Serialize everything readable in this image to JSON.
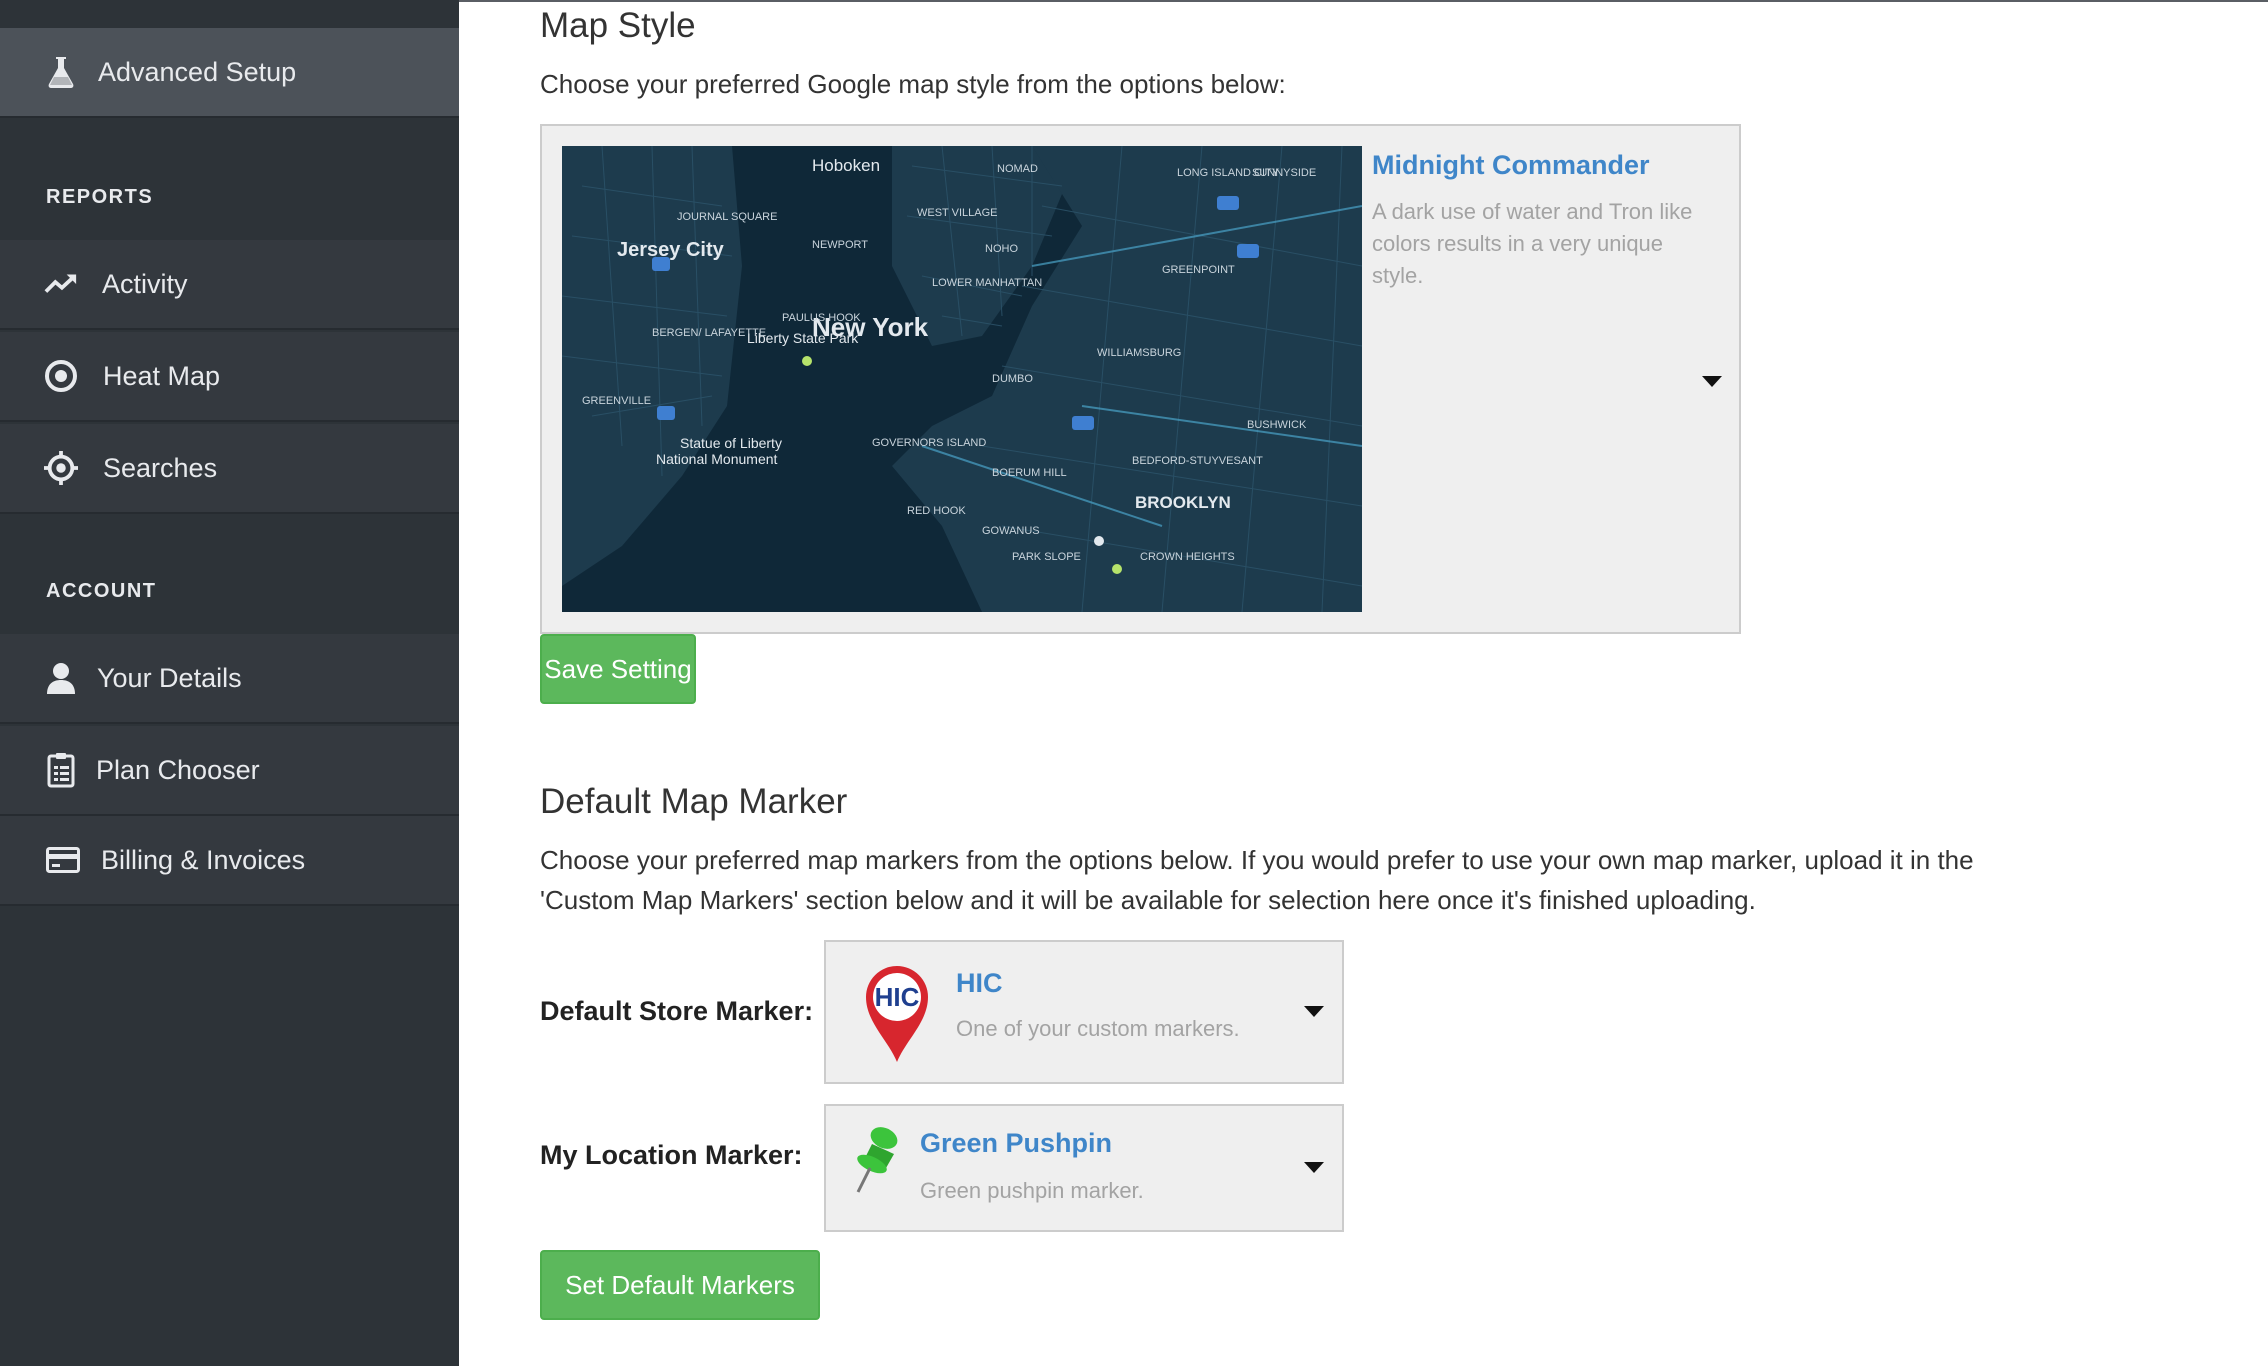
{
  "sidebar": {
    "advanced_setup": "Advanced Setup",
    "reports_heading": "REPORTS",
    "activity": "Activity",
    "heat_map": "Heat Map",
    "searches": "Searches",
    "account_heading": "ACCOUNT",
    "your_details": "Your Details",
    "plan_chooser": "Plan Chooser",
    "billing": "Billing & Invoices",
    "icons": [
      "flask-icon",
      "trend-up-icon",
      "target-icon",
      "crosshair-icon",
      "user-icon",
      "clipboard-icon",
      "credit-card-icon"
    ]
  },
  "map_style": {
    "heading": "Map Style",
    "description": "Choose your preferred Google map style from the options below:",
    "selected_title": "Midnight Commander",
    "selected_desc": "A dark use of water and Tron like colors results in a very unique style.",
    "save_button": "Save Setting",
    "map_labels": {
      "hoboken": "Hoboken",
      "jersey_city": "Jersey City",
      "new_york": "New York",
      "brooklyn": "BROOKLYN",
      "liberty": "Liberty State Park",
      "statue": "Statue of Liberty",
      "statue2": "National Monument",
      "journal_square": "JOURNAL SQUARE",
      "newport": "NEWPORT",
      "paulus_hook": "PAULUS HOOK",
      "west_village": "WEST VILLAGE",
      "lower_manhattan": "LOWER MANHATTAN",
      "williamsburg": "WILLIAMSBURG",
      "greenpoint": "GREENPOINT",
      "dumbo": "DUMBO",
      "boerum_hill": "BOERUM HILL",
      "red_hook": "RED HOOK",
      "park_slope": "PARK SLOPE",
      "crown_heights": "CROWN HEIGHTS",
      "governors_island": "GOVERNORS ISLAND",
      "greenville": "GREENVILLE",
      "bergen": "BERGEN/ LAFAYETTE",
      "long_island_city": "LONG ISLAND CITY",
      "sunnyside": "SUNNYSIDE",
      "bushwick": "BUSHWICK",
      "bed_stuy": "BEDFORD-STUYVESANT",
      "gowanus": "GOWANUS",
      "nomad": "NOMAD",
      "noho": "NOHO"
    }
  },
  "default_marker": {
    "heading": "Default Map Marker",
    "description_line1": "Choose your preferred map markers from the options below. If you would prefer to use your own map marker, upload it in the",
    "description_line2": "'Custom Map Markers' section below and it will be available for selection here once it's finished uploading.",
    "store_label": "Default Store Marker:",
    "store_title": "HIC",
    "store_desc": "One of your custom markers.",
    "store_badge": "HIC",
    "location_label": "My Location Marker:",
    "location_title": "Green Pushpin",
    "location_desc": "Green pushpin marker.",
    "set_button": "Set Default Markers",
    "colors": {
      "accent": "#3f86c9",
      "button": "#5cb85c",
      "sidebar": "#2d3338",
      "marker_red": "#d7262e",
      "pushpin_green": "#3cc43c"
    }
  }
}
